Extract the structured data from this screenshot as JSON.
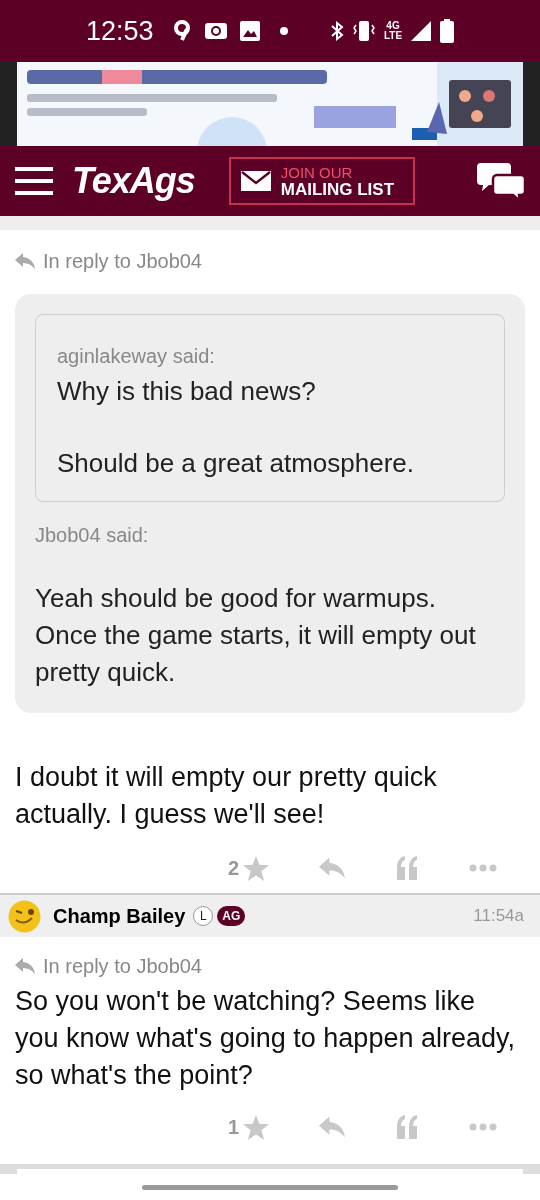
{
  "status_bar": {
    "time": "12:53",
    "network": "4G LTE"
  },
  "header": {
    "logo": "TexAgs",
    "mailing_button": {
      "line_1": "JOIN OUR",
      "line_2": "MAILING LIST"
    }
  },
  "posts": [
    {
      "in_reply_to": "In reply to Jbob04",
      "quote": {
        "author": "Jbob04 said:",
        "nested_quote": {
          "author": "aginlakeway said:",
          "paragraphs": [
            "Why is this bad news?",
            "Should be a great atmosphere."
          ]
        },
        "paragraphs": [
          "Yeah should be good for warmups. Once the game starts, it will empty out pretty quick."
        ]
      },
      "body": "I doubt it will empty our pretty quick actually. I guess we'll see!",
      "stars_count": "2"
    },
    {
      "author": {
        "name": "Champ Bailey",
        "badges": [
          "L",
          "AG"
        ],
        "time": "11:54a"
      },
      "in_reply_to": "In reply to Jbob04",
      "body": "So you won't be watching? Seems like you know what's going to happen already, so what's the point?",
      "stars_count": "1"
    }
  ]
}
